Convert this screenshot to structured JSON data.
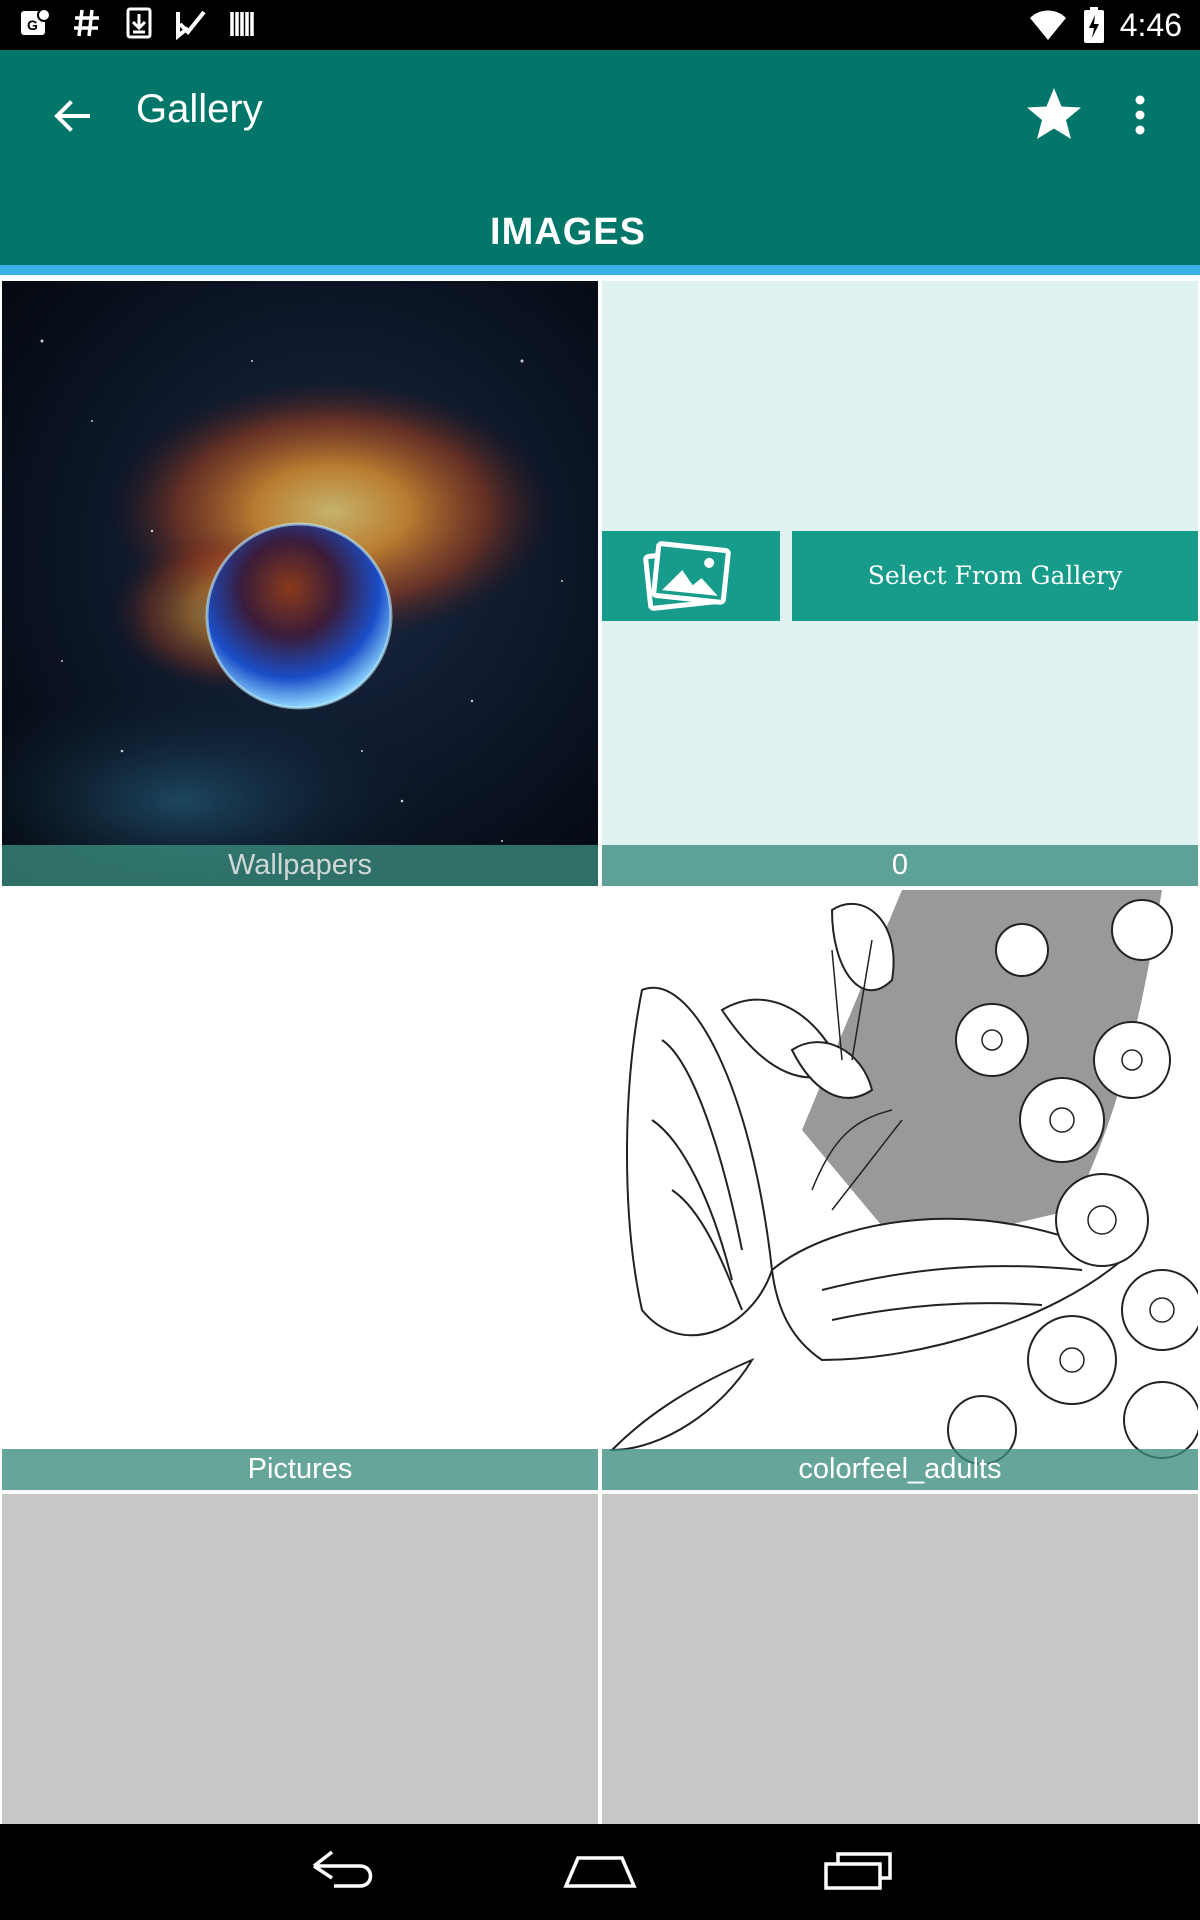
{
  "status_bar": {
    "time": "4:46",
    "icons": [
      "maps-icon",
      "hash-icon",
      "download-icon",
      "check-icon",
      "barcode-icon",
      "wifi-icon",
      "battery-charging-icon"
    ]
  },
  "app_bar": {
    "title": "Gallery",
    "back_icon": "arrow-back-icon",
    "favorite_icon": "star-icon",
    "menu_icon": "more-vert-icon"
  },
  "tabs": [
    {
      "label": "IMAGES",
      "active": true
    }
  ],
  "colors": {
    "app_bar": "#03766a",
    "tab_indicator": "#39b0e6",
    "select_button": "#179b8a",
    "tile_placeholder": "#e0f2f1",
    "empty_tile": "#c8c8c8"
  },
  "albums": [
    {
      "name": "Wallpapers",
      "thumbnail": "space-planet-image"
    },
    {
      "name": "0",
      "select_button_label": "Select From Gallery",
      "select_icon": "gallery-photos-icon"
    },
    {
      "name": "Pictures",
      "thumbnail": ""
    },
    {
      "name": "colorfeel_adults",
      "thumbnail": "butterfly-line-art-image"
    },
    {
      "name": "",
      "thumbnail": ""
    },
    {
      "name": "",
      "thumbnail": ""
    }
  ],
  "nav_bar": {
    "buttons": [
      "nav-back-icon",
      "nav-home-icon",
      "nav-recents-icon"
    ]
  }
}
